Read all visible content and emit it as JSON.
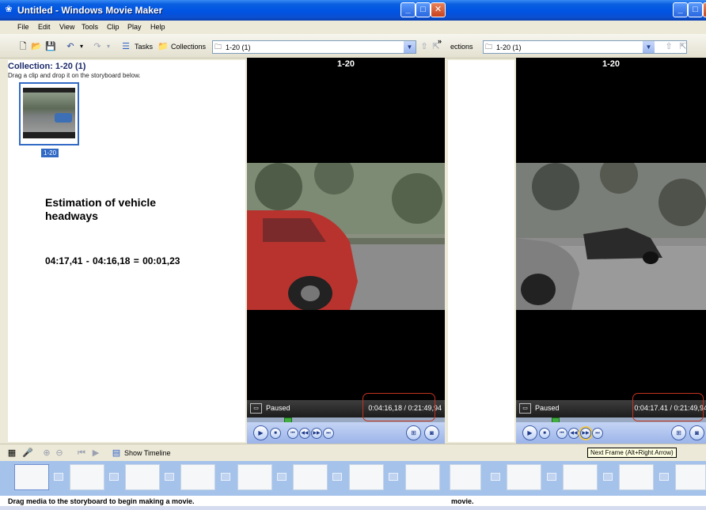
{
  "left": {
    "window_title": "Untitled - Windows Movie Maker",
    "menu": [
      "File",
      "Edit",
      "View",
      "Tools",
      "Clip",
      "Play",
      "Help"
    ],
    "toolbar": {
      "tasks_label": "Tasks",
      "collections_label": "Collections",
      "collection_select": "1-20 (1)",
      "more": "»"
    },
    "collection_heading": "Collection: 1-20 (1)",
    "collection_hint": "Drag a clip and drop it on the storyboard below.",
    "clip_label": "1-20",
    "annotation": {
      "title_line1": "Estimation of vehicle",
      "title_line2": "headways",
      "formula": "04:17,41 - 04:16,18  = 00:01,23"
    },
    "monitor": {
      "title": "1-20",
      "status": "Paused",
      "time": "0:04:16,18 / 0:21:49,94",
      "seek_fraction": 0.195
    },
    "storyboard": {
      "show_timeline": "Show Timeline",
      "hint": "Drag media to the storyboard to begin making a movie."
    }
  },
  "right": {
    "toolbar": {
      "collections_partial": "ections",
      "collection_select": "1-20 (1)"
    },
    "monitor": {
      "title": "1-20",
      "status": "Paused",
      "time": "0:04:17.41 / 0:21:49,94",
      "seek_fraction": 0.195
    },
    "tooltip": "Next Frame (Alt+Right Arrow)",
    "hint_partial": "movie."
  },
  "colors": {
    "titlebar": "#0054e3",
    "highlight": "#c2331f",
    "storyboard": "#a5c3ea"
  }
}
